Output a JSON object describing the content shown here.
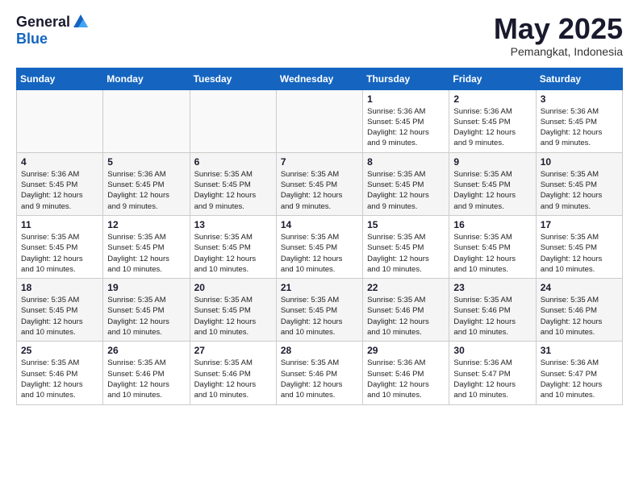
{
  "header": {
    "logo_general": "General",
    "logo_blue": "Blue",
    "month_title": "May 2025",
    "location": "Pemangkat, Indonesia"
  },
  "days_of_week": [
    "Sunday",
    "Monday",
    "Tuesday",
    "Wednesday",
    "Thursday",
    "Friday",
    "Saturday"
  ],
  "weeks": [
    [
      {
        "day": "",
        "info": ""
      },
      {
        "day": "",
        "info": ""
      },
      {
        "day": "",
        "info": ""
      },
      {
        "day": "",
        "info": ""
      },
      {
        "day": "1",
        "info": "Sunrise: 5:36 AM\nSunset: 5:45 PM\nDaylight: 12 hours\nand 9 minutes."
      },
      {
        "day": "2",
        "info": "Sunrise: 5:36 AM\nSunset: 5:45 PM\nDaylight: 12 hours\nand 9 minutes."
      },
      {
        "day": "3",
        "info": "Sunrise: 5:36 AM\nSunset: 5:45 PM\nDaylight: 12 hours\nand 9 minutes."
      }
    ],
    [
      {
        "day": "4",
        "info": "Sunrise: 5:36 AM\nSunset: 5:45 PM\nDaylight: 12 hours\nand 9 minutes."
      },
      {
        "day": "5",
        "info": "Sunrise: 5:36 AM\nSunset: 5:45 PM\nDaylight: 12 hours\nand 9 minutes."
      },
      {
        "day": "6",
        "info": "Sunrise: 5:35 AM\nSunset: 5:45 PM\nDaylight: 12 hours\nand 9 minutes."
      },
      {
        "day": "7",
        "info": "Sunrise: 5:35 AM\nSunset: 5:45 PM\nDaylight: 12 hours\nand 9 minutes."
      },
      {
        "day": "8",
        "info": "Sunrise: 5:35 AM\nSunset: 5:45 PM\nDaylight: 12 hours\nand 9 minutes."
      },
      {
        "day": "9",
        "info": "Sunrise: 5:35 AM\nSunset: 5:45 PM\nDaylight: 12 hours\nand 9 minutes."
      },
      {
        "day": "10",
        "info": "Sunrise: 5:35 AM\nSunset: 5:45 PM\nDaylight: 12 hours\nand 9 minutes."
      }
    ],
    [
      {
        "day": "11",
        "info": "Sunrise: 5:35 AM\nSunset: 5:45 PM\nDaylight: 12 hours\nand 10 minutes."
      },
      {
        "day": "12",
        "info": "Sunrise: 5:35 AM\nSunset: 5:45 PM\nDaylight: 12 hours\nand 10 minutes."
      },
      {
        "day": "13",
        "info": "Sunrise: 5:35 AM\nSunset: 5:45 PM\nDaylight: 12 hours\nand 10 minutes."
      },
      {
        "day": "14",
        "info": "Sunrise: 5:35 AM\nSunset: 5:45 PM\nDaylight: 12 hours\nand 10 minutes."
      },
      {
        "day": "15",
        "info": "Sunrise: 5:35 AM\nSunset: 5:45 PM\nDaylight: 12 hours\nand 10 minutes."
      },
      {
        "day": "16",
        "info": "Sunrise: 5:35 AM\nSunset: 5:45 PM\nDaylight: 12 hours\nand 10 minutes."
      },
      {
        "day": "17",
        "info": "Sunrise: 5:35 AM\nSunset: 5:45 PM\nDaylight: 12 hours\nand 10 minutes."
      }
    ],
    [
      {
        "day": "18",
        "info": "Sunrise: 5:35 AM\nSunset: 5:45 PM\nDaylight: 12 hours\nand 10 minutes."
      },
      {
        "day": "19",
        "info": "Sunrise: 5:35 AM\nSunset: 5:45 PM\nDaylight: 12 hours\nand 10 minutes."
      },
      {
        "day": "20",
        "info": "Sunrise: 5:35 AM\nSunset: 5:45 PM\nDaylight: 12 hours\nand 10 minutes."
      },
      {
        "day": "21",
        "info": "Sunrise: 5:35 AM\nSunset: 5:45 PM\nDaylight: 12 hours\nand 10 minutes."
      },
      {
        "day": "22",
        "info": "Sunrise: 5:35 AM\nSunset: 5:46 PM\nDaylight: 12 hours\nand 10 minutes."
      },
      {
        "day": "23",
        "info": "Sunrise: 5:35 AM\nSunset: 5:46 PM\nDaylight: 12 hours\nand 10 minutes."
      },
      {
        "day": "24",
        "info": "Sunrise: 5:35 AM\nSunset: 5:46 PM\nDaylight: 12 hours\nand 10 minutes."
      }
    ],
    [
      {
        "day": "25",
        "info": "Sunrise: 5:35 AM\nSunset: 5:46 PM\nDaylight: 12 hours\nand 10 minutes."
      },
      {
        "day": "26",
        "info": "Sunrise: 5:35 AM\nSunset: 5:46 PM\nDaylight: 12 hours\nand 10 minutes."
      },
      {
        "day": "27",
        "info": "Sunrise: 5:35 AM\nSunset: 5:46 PM\nDaylight: 12 hours\nand 10 minutes."
      },
      {
        "day": "28",
        "info": "Sunrise: 5:35 AM\nSunset: 5:46 PM\nDaylight: 12 hours\nand 10 minutes."
      },
      {
        "day": "29",
        "info": "Sunrise: 5:36 AM\nSunset: 5:46 PM\nDaylight: 12 hours\nand 10 minutes."
      },
      {
        "day": "30",
        "info": "Sunrise: 5:36 AM\nSunset: 5:47 PM\nDaylight: 12 hours\nand 10 minutes."
      },
      {
        "day": "31",
        "info": "Sunrise: 5:36 AM\nSunset: 5:47 PM\nDaylight: 12 hours\nand 10 minutes."
      }
    ]
  ]
}
